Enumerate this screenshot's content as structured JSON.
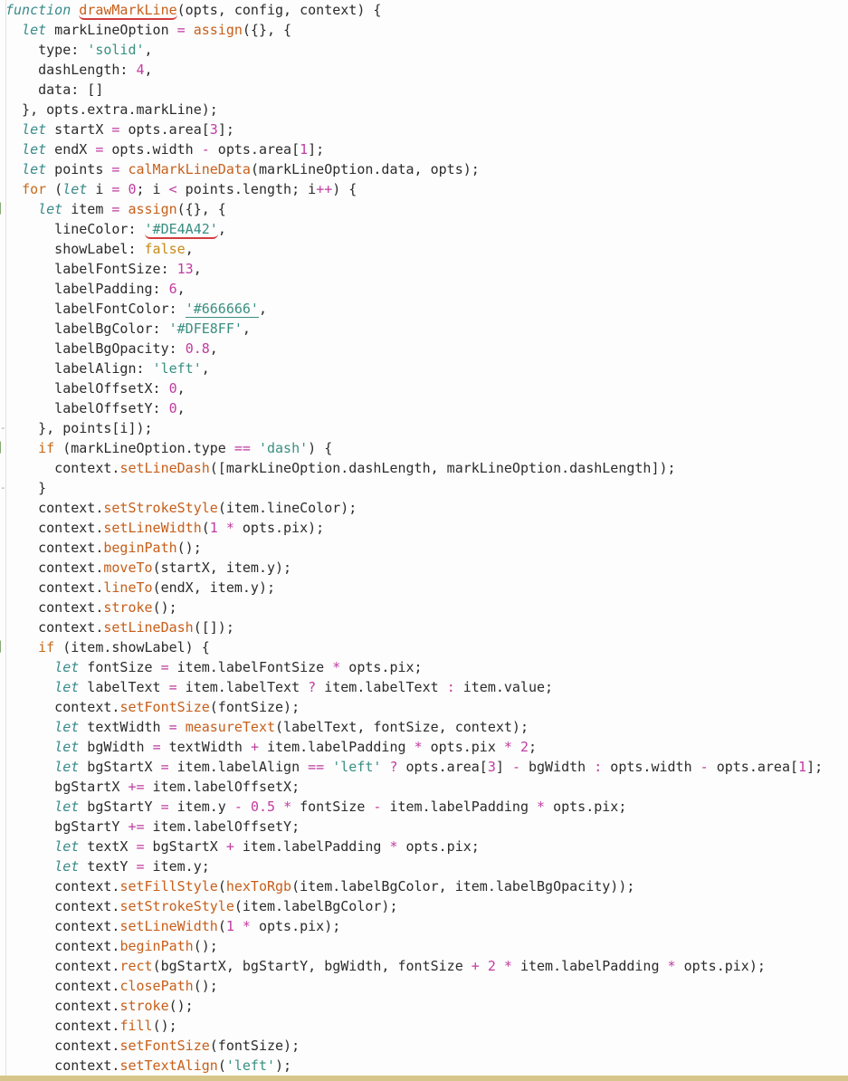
{
  "editor": {
    "language": "javascript",
    "lines": [
      [
        {
          "t": "kw",
          "v": "function"
        },
        {
          "t": "p",
          "v": " "
        },
        {
          "t": "fn",
          "v": "drawMarkLine",
          "mark": "squiggle-red"
        },
        {
          "t": "p",
          "v": "(opts, config, context) {"
        }
      ],
      [
        {
          "t": "p",
          "v": "  "
        },
        {
          "t": "kw",
          "v": "let"
        },
        {
          "t": "p",
          "v": " markLineOption "
        },
        {
          "t": "op",
          "v": "="
        },
        {
          "t": "p",
          "v": " "
        },
        {
          "t": "fn",
          "v": "assign"
        },
        {
          "t": "p",
          "v": "({}, {"
        }
      ],
      [
        {
          "t": "p",
          "v": "    type: "
        },
        {
          "t": "str",
          "v": "'solid'"
        },
        {
          "t": "p",
          "v": ","
        }
      ],
      [
        {
          "t": "p",
          "v": "    dashLength: "
        },
        {
          "t": "num",
          "v": "4"
        },
        {
          "t": "p",
          "v": ","
        }
      ],
      [
        {
          "t": "p",
          "v": "    data: []"
        }
      ],
      [
        {
          "t": "p",
          "v": "  }, opts.extra.markLine);"
        }
      ],
      [
        {
          "t": "p",
          "v": "  "
        },
        {
          "t": "kw",
          "v": "let"
        },
        {
          "t": "p",
          "v": " startX "
        },
        {
          "t": "op",
          "v": "="
        },
        {
          "t": "p",
          "v": " opts.area["
        },
        {
          "t": "num",
          "v": "3"
        },
        {
          "t": "p",
          "v": "];"
        }
      ],
      [
        {
          "t": "p",
          "v": "  "
        },
        {
          "t": "kw",
          "v": "let"
        },
        {
          "t": "p",
          "v": " endX "
        },
        {
          "t": "op",
          "v": "="
        },
        {
          "t": "p",
          "v": " opts.width "
        },
        {
          "t": "op",
          "v": "-"
        },
        {
          "t": "p",
          "v": " opts.area["
        },
        {
          "t": "num",
          "v": "1"
        },
        {
          "t": "p",
          "v": "];"
        }
      ],
      [
        {
          "t": "p",
          "v": "  "
        },
        {
          "t": "kw",
          "v": "let"
        },
        {
          "t": "p",
          "v": " points "
        },
        {
          "t": "op",
          "v": "="
        },
        {
          "t": "p",
          "v": " "
        },
        {
          "t": "fn",
          "v": "calMarkLineData"
        },
        {
          "t": "p",
          "v": "(markLineOption.data, opts);"
        }
      ],
      [
        {
          "t": "p",
          "v": "  "
        },
        {
          "t": "kw2",
          "v": "for"
        },
        {
          "t": "p",
          "v": " ("
        },
        {
          "t": "kw",
          "v": "let"
        },
        {
          "t": "p",
          "v": " i "
        },
        {
          "t": "op",
          "v": "="
        },
        {
          "t": "p",
          "v": " "
        },
        {
          "t": "num",
          "v": "0"
        },
        {
          "t": "p",
          "v": "; i "
        },
        {
          "t": "op",
          "v": "<"
        },
        {
          "t": "p",
          "v": " points.length; i"
        },
        {
          "t": "op",
          "v": "++"
        },
        {
          "t": "p",
          "v": ") {"
        }
      ],
      [
        {
          "t": "p",
          "v": "    "
        },
        {
          "t": "kw",
          "v": "let"
        },
        {
          "t": "p",
          "v": " item "
        },
        {
          "t": "op",
          "v": "="
        },
        {
          "t": "p",
          "v": " "
        },
        {
          "t": "fn",
          "v": "assign"
        },
        {
          "t": "p",
          "v": "({}, {"
        }
      ],
      [
        {
          "t": "p",
          "v": "      lineColor: "
        },
        {
          "t": "str",
          "v": "'#DE4A42'",
          "mark": "squiggle-red"
        },
        {
          "t": "p",
          "v": ","
        }
      ],
      [
        {
          "t": "p",
          "v": "      showLabel: "
        },
        {
          "t": "bool",
          "v": "false"
        },
        {
          "t": "p",
          "v": ","
        }
      ],
      [
        {
          "t": "p",
          "v": "      labelFontSize: "
        },
        {
          "t": "num",
          "v": "13"
        },
        {
          "t": "p",
          "v": ","
        }
      ],
      [
        {
          "t": "p",
          "v": "      labelPadding: "
        },
        {
          "t": "num",
          "v": "6"
        },
        {
          "t": "p",
          "v": ","
        }
      ],
      [
        {
          "t": "p",
          "v": "      labelFontColor: "
        },
        {
          "t": "str",
          "v": "'#666666'",
          "mark": "underline-teal"
        },
        {
          "t": "p",
          "v": ","
        }
      ],
      [
        {
          "t": "p",
          "v": "      labelBgColor: "
        },
        {
          "t": "str",
          "v": "'#DFE8FF'"
        },
        {
          "t": "p",
          "v": ","
        }
      ],
      [
        {
          "t": "p",
          "v": "      labelBgOpacity: "
        },
        {
          "t": "num",
          "v": "0.8"
        },
        {
          "t": "p",
          "v": ","
        }
      ],
      [
        {
          "t": "p",
          "v": "      labelAlign: "
        },
        {
          "t": "str",
          "v": "'left'"
        },
        {
          "t": "p",
          "v": ","
        }
      ],
      [
        {
          "t": "p",
          "v": "      labelOffsetX: "
        },
        {
          "t": "num",
          "v": "0"
        },
        {
          "t": "p",
          "v": ","
        }
      ],
      [
        {
          "t": "p",
          "v": "      labelOffsetY: "
        },
        {
          "t": "num",
          "v": "0"
        },
        {
          "t": "p",
          "v": ","
        }
      ],
      [
        {
          "t": "p",
          "v": "    }, points[i]);"
        }
      ],
      [
        {
          "t": "p",
          "v": "    "
        },
        {
          "t": "kw2",
          "v": "if"
        },
        {
          "t": "p",
          "v": " (markLineOption.type "
        },
        {
          "t": "op",
          "v": "=="
        },
        {
          "t": "p",
          "v": " "
        },
        {
          "t": "str",
          "v": "'dash'"
        },
        {
          "t": "p",
          "v": ") {"
        }
      ],
      [
        {
          "t": "p",
          "v": "      context."
        },
        {
          "t": "fn",
          "v": "setLineDash"
        },
        {
          "t": "p",
          "v": "([markLineOption.dashLength, markLineOption.dashLength]);"
        }
      ],
      [
        {
          "t": "p",
          "v": "    }"
        }
      ],
      [
        {
          "t": "p",
          "v": "    context."
        },
        {
          "t": "fn",
          "v": "setStrokeStyle"
        },
        {
          "t": "p",
          "v": "(item.lineColor);"
        }
      ],
      [
        {
          "t": "p",
          "v": "    context."
        },
        {
          "t": "fn",
          "v": "setLineWidth"
        },
        {
          "t": "p",
          "v": "("
        },
        {
          "t": "num",
          "v": "1"
        },
        {
          "t": "p",
          "v": " "
        },
        {
          "t": "op",
          "v": "*"
        },
        {
          "t": "p",
          "v": " opts.pix);"
        }
      ],
      [
        {
          "t": "p",
          "v": "    context."
        },
        {
          "t": "fn",
          "v": "beginPath"
        },
        {
          "t": "p",
          "v": "();"
        }
      ],
      [
        {
          "t": "p",
          "v": "    context."
        },
        {
          "t": "fn",
          "v": "moveTo"
        },
        {
          "t": "p",
          "v": "(startX, item.y);"
        }
      ],
      [
        {
          "t": "p",
          "v": "    context."
        },
        {
          "t": "fn",
          "v": "lineTo"
        },
        {
          "t": "p",
          "v": "(endX, item.y);"
        }
      ],
      [
        {
          "t": "p",
          "v": "    context."
        },
        {
          "t": "fn",
          "v": "stroke"
        },
        {
          "t": "p",
          "v": "();"
        }
      ],
      [
        {
          "t": "p",
          "v": "    context."
        },
        {
          "t": "fn",
          "v": "setLineDash"
        },
        {
          "t": "p",
          "v": "([]);"
        }
      ],
      [
        {
          "t": "p",
          "v": "    "
        },
        {
          "t": "kw2",
          "v": "if"
        },
        {
          "t": "p",
          "v": " (item.showLabel) {"
        }
      ],
      [
        {
          "t": "p",
          "v": "      "
        },
        {
          "t": "kw",
          "v": "let"
        },
        {
          "t": "p",
          "v": " fontSize "
        },
        {
          "t": "op",
          "v": "="
        },
        {
          "t": "p",
          "v": " item.labelFontSize "
        },
        {
          "t": "op",
          "v": "*"
        },
        {
          "t": "p",
          "v": " opts.pix;"
        }
      ],
      [
        {
          "t": "p",
          "v": "      "
        },
        {
          "t": "kw",
          "v": "let"
        },
        {
          "t": "p",
          "v": " labelText "
        },
        {
          "t": "op",
          "v": "="
        },
        {
          "t": "p",
          "v": " item.labelText "
        },
        {
          "t": "op",
          "v": "?"
        },
        {
          "t": "p",
          "v": " item.labelText "
        },
        {
          "t": "op",
          "v": ":"
        },
        {
          "t": "p",
          "v": " item.value;"
        }
      ],
      [
        {
          "t": "p",
          "v": "      context."
        },
        {
          "t": "fn",
          "v": "setFontSize"
        },
        {
          "t": "p",
          "v": "(fontSize);"
        }
      ],
      [
        {
          "t": "p",
          "v": "      "
        },
        {
          "t": "kw",
          "v": "let"
        },
        {
          "t": "p",
          "v": " textWidth "
        },
        {
          "t": "op",
          "v": "="
        },
        {
          "t": "p",
          "v": " "
        },
        {
          "t": "fn",
          "v": "measureText"
        },
        {
          "t": "p",
          "v": "(labelText, fontSize, context);"
        }
      ],
      [
        {
          "t": "p",
          "v": "      "
        },
        {
          "t": "kw",
          "v": "let"
        },
        {
          "t": "p",
          "v": " bgWidth "
        },
        {
          "t": "op",
          "v": "="
        },
        {
          "t": "p",
          "v": " textWidth "
        },
        {
          "t": "op",
          "v": "+"
        },
        {
          "t": "p",
          "v": " item.labelPadding "
        },
        {
          "t": "op",
          "v": "*"
        },
        {
          "t": "p",
          "v": " opts.pix "
        },
        {
          "t": "op",
          "v": "*"
        },
        {
          "t": "p",
          "v": " "
        },
        {
          "t": "num",
          "v": "2"
        },
        {
          "t": "p",
          "v": ";"
        }
      ],
      [
        {
          "t": "p",
          "v": "      "
        },
        {
          "t": "kw",
          "v": "let"
        },
        {
          "t": "p",
          "v": " bgStartX "
        },
        {
          "t": "op",
          "v": "="
        },
        {
          "t": "p",
          "v": " item.labelAlign "
        },
        {
          "t": "op",
          "v": "=="
        },
        {
          "t": "p",
          "v": " "
        },
        {
          "t": "str",
          "v": "'left'"
        },
        {
          "t": "p",
          "v": " "
        },
        {
          "t": "op",
          "v": "?"
        },
        {
          "t": "p",
          "v": " opts.area["
        },
        {
          "t": "num",
          "v": "3"
        },
        {
          "t": "p",
          "v": "] "
        },
        {
          "t": "op",
          "v": "-"
        },
        {
          "t": "p",
          "v": " bgWidth "
        },
        {
          "t": "op",
          "v": ":"
        },
        {
          "t": "p",
          "v": " opts.width "
        },
        {
          "t": "op",
          "v": "-"
        },
        {
          "t": "p",
          "v": " opts.area["
        },
        {
          "t": "num",
          "v": "1"
        },
        {
          "t": "p",
          "v": "];"
        }
      ],
      [
        {
          "t": "p",
          "v": "      bgStartX "
        },
        {
          "t": "op",
          "v": "+="
        },
        {
          "t": "p",
          "v": " item.labelOffsetX;"
        }
      ],
      [
        {
          "t": "p",
          "v": "      "
        },
        {
          "t": "kw",
          "v": "let"
        },
        {
          "t": "p",
          "v": " bgStartY "
        },
        {
          "t": "op",
          "v": "="
        },
        {
          "t": "p",
          "v": " item.y "
        },
        {
          "t": "op",
          "v": "-"
        },
        {
          "t": "p",
          "v": " "
        },
        {
          "t": "num",
          "v": "0.5"
        },
        {
          "t": "p",
          "v": " "
        },
        {
          "t": "op",
          "v": "*"
        },
        {
          "t": "p",
          "v": " fontSize "
        },
        {
          "t": "op",
          "v": "-"
        },
        {
          "t": "p",
          "v": " item.labelPadding "
        },
        {
          "t": "op",
          "v": "*"
        },
        {
          "t": "p",
          "v": " opts.pix;"
        }
      ],
      [
        {
          "t": "p",
          "v": "      bgStartY "
        },
        {
          "t": "op",
          "v": "+="
        },
        {
          "t": "p",
          "v": " item.labelOffsetY;"
        }
      ],
      [
        {
          "t": "p",
          "v": "      "
        },
        {
          "t": "kw",
          "v": "let"
        },
        {
          "t": "p",
          "v": " textX "
        },
        {
          "t": "op",
          "v": "="
        },
        {
          "t": "p",
          "v": " bgStartX "
        },
        {
          "t": "op",
          "v": "+"
        },
        {
          "t": "p",
          "v": " item.labelPadding "
        },
        {
          "t": "op",
          "v": "*"
        },
        {
          "t": "p",
          "v": " opts.pix;"
        }
      ],
      [
        {
          "t": "p",
          "v": "      "
        },
        {
          "t": "kw",
          "v": "let"
        },
        {
          "t": "p",
          "v": " textY "
        },
        {
          "t": "op",
          "v": "="
        },
        {
          "t": "p",
          "v": " item.y;"
        }
      ],
      [
        {
          "t": "p",
          "v": "      context."
        },
        {
          "t": "fn",
          "v": "setFillStyle"
        },
        {
          "t": "p",
          "v": "("
        },
        {
          "t": "fn",
          "v": "hexToRgb"
        },
        {
          "t": "p",
          "v": "(item.labelBgColor, item.labelBgOpacity));"
        }
      ],
      [
        {
          "t": "p",
          "v": "      context."
        },
        {
          "t": "fn",
          "v": "setStrokeStyle"
        },
        {
          "t": "p",
          "v": "(item.labelBgColor);"
        }
      ],
      [
        {
          "t": "p",
          "v": "      context."
        },
        {
          "t": "fn",
          "v": "setLineWidth"
        },
        {
          "t": "p",
          "v": "("
        },
        {
          "t": "num",
          "v": "1"
        },
        {
          "t": "p",
          "v": " "
        },
        {
          "t": "op",
          "v": "*"
        },
        {
          "t": "p",
          "v": " opts.pix);"
        }
      ],
      [
        {
          "t": "p",
          "v": "      context."
        },
        {
          "t": "fn",
          "v": "beginPath"
        },
        {
          "t": "p",
          "v": "();"
        }
      ],
      [
        {
          "t": "p",
          "v": "      context."
        },
        {
          "t": "fn",
          "v": "rect"
        },
        {
          "t": "p",
          "v": "(bgStartX, bgStartY, bgWidth, fontSize "
        },
        {
          "t": "op",
          "v": "+"
        },
        {
          "t": "p",
          "v": " "
        },
        {
          "t": "num",
          "v": "2"
        },
        {
          "t": "p",
          "v": " "
        },
        {
          "t": "op",
          "v": "*"
        },
        {
          "t": "p",
          "v": " item.labelPadding "
        },
        {
          "t": "op",
          "v": "*"
        },
        {
          "t": "p",
          "v": " opts.pix);"
        }
      ],
      [
        {
          "t": "p",
          "v": "      context."
        },
        {
          "t": "fn",
          "v": "closePath"
        },
        {
          "t": "p",
          "v": "();"
        }
      ],
      [
        {
          "t": "p",
          "v": "      context."
        },
        {
          "t": "fn",
          "v": "stroke"
        },
        {
          "t": "p",
          "v": "();"
        }
      ],
      [
        {
          "t": "p",
          "v": "      context."
        },
        {
          "t": "fn",
          "v": "fill"
        },
        {
          "t": "p",
          "v": "();"
        }
      ],
      [
        {
          "t": "p",
          "v": "      context."
        },
        {
          "t": "fn",
          "v": "setFontSize"
        },
        {
          "t": "p",
          "v": "(fontSize);"
        }
      ],
      [
        {
          "t": "p",
          "v": "      context."
        },
        {
          "t": "fn",
          "v": "setTextAlign"
        },
        {
          "t": "p",
          "v": "("
        },
        {
          "t": "str",
          "v": "'left'"
        },
        {
          "t": "p",
          "v": ");"
        }
      ]
    ],
    "fold_marker_lines": [
      10,
      22,
      32
    ],
    "fold_end_lines": [
      21,
      24
    ],
    "colors": {
      "keyword": "#3a8a8a",
      "control": "#c76b1a",
      "function": "#c75f1a",
      "string": "#3a8f82",
      "number": "#c03ca0",
      "error_underline": "#d43d3d"
    }
  }
}
